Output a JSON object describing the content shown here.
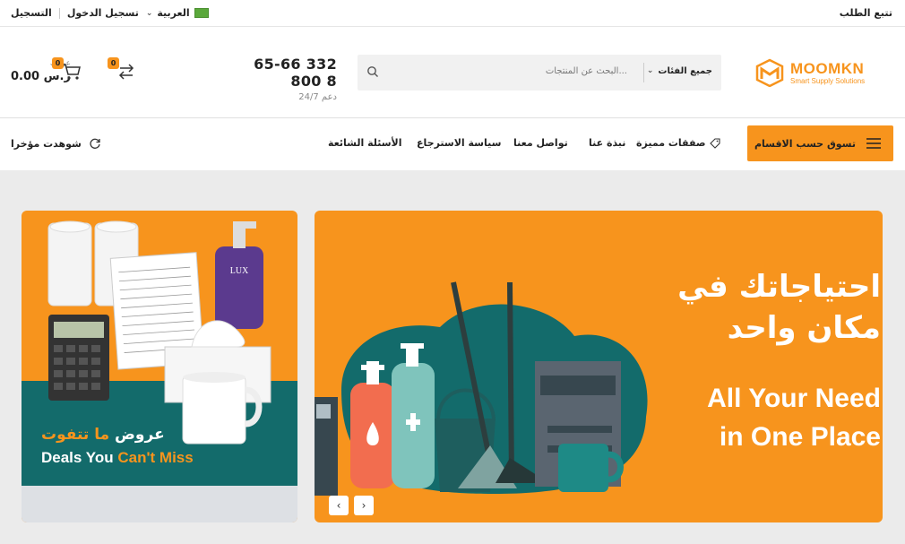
{
  "topbar": {
    "register": "التسجيل",
    "login": "تسجيل الدخول",
    "language": "العربية",
    "track_order": "تتبع الطلب"
  },
  "header": {
    "cart": {
      "label": "عربتك",
      "amount": "0.00 ر.س",
      "count": "0"
    },
    "compare": {
      "count": "0"
    },
    "phone": {
      "number": "65-66 332 800 8",
      "support": "24/7 دعم"
    },
    "search": {
      "placeholder": "البحث عن المنتجات...",
      "category": "جميع الفئات"
    },
    "logo": {
      "name": "MOOMKN",
      "tagline": "Smart Supply Solutions"
    }
  },
  "nav": {
    "recently_viewed": "شوهدت مؤخرا",
    "items": [
      "الأسئلة الشائعة",
      "سياسة الاسترجاع",
      "تواصل معنا",
      "نبذة عنا",
      "صفقات مميزة"
    ],
    "shop_by_category": "تسوق حسب الاقسام"
  },
  "banners": {
    "main": {
      "arabic_line1": "احتياجاتك في",
      "arabic_line2": "مكان واحد",
      "english_line1": "All Your Need",
      "english_line2": "in One Place"
    },
    "side": {
      "arabic_plain": "عروض ",
      "arabic_highlight": "ما تتفوت",
      "english_plain": "Deals You ",
      "english_highlight": "Can't Miss"
    }
  },
  "colors": {
    "accent": "#f7941d",
    "teal": "#136b6b",
    "background": "#ebebeb"
  }
}
